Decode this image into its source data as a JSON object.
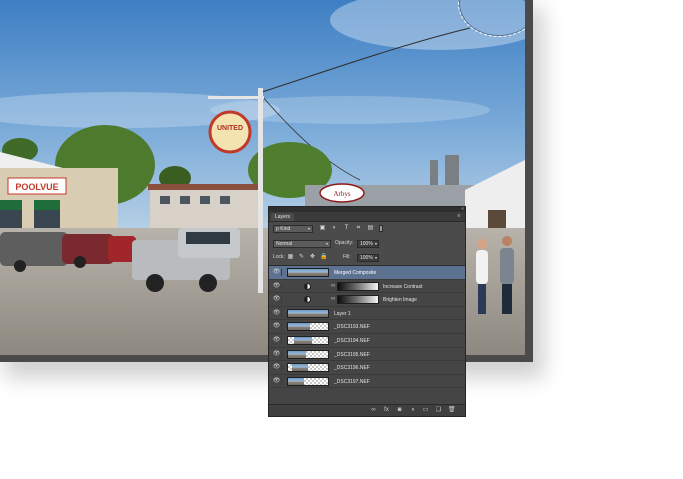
{
  "document": {
    "sign_roadside": "POOLVUE",
    "sign_round": "UNITED",
    "sign_oval": "Arbys"
  },
  "layers_panel": {
    "tab_label": "Layers",
    "collapse_glyph": "«",
    "menu_glyph": "≡",
    "filter": {
      "kind_label": "Kind",
      "kind_prefix": "ρ",
      "caret": "▾",
      "icons": [
        "image-filter-icon",
        "adjustment-filter-icon",
        "type-filter-icon",
        "shape-filter-icon",
        "smart-object-filter-icon"
      ],
      "glyphs": [
        "▣",
        "◐",
        "T",
        "⌗",
        "▤"
      ]
    },
    "blend_mode": "Normal",
    "opacity_label": "Opacity:",
    "opacity_value": "100%",
    "lock_label": "Lock:",
    "lock_glyphs": [
      "▦",
      "✎",
      "✥",
      "🔒"
    ],
    "fill_label": "Fill:",
    "fill_value": "100%",
    "eye_glyph": "👁",
    "chain_glyph": "∞",
    "layers": [
      {
        "name": "Merged Composite",
        "kind": "pixel",
        "selected": true,
        "thumb": "full"
      },
      {
        "name": "Increase Contrast",
        "kind": "adjustment",
        "selected": false
      },
      {
        "name": "Brighten Image",
        "kind": "adjustment",
        "selected": false
      },
      {
        "name": "Layer 1",
        "kind": "pixel",
        "selected": false,
        "thumb": "full"
      },
      {
        "name": "_DSC3193.NEF",
        "kind": "pixel",
        "selected": false,
        "thumb": "partial",
        "chip_start": 0.0,
        "chip_end": 0.55
      },
      {
        "name": "_DSC3194.NEF",
        "kind": "pixel",
        "selected": false,
        "thumb": "partial",
        "chip_start": 0.15,
        "chip_end": 0.6
      },
      {
        "name": "_DSC3195.NEF",
        "kind": "pixel",
        "selected": false,
        "thumb": "partial",
        "chip_start": 0.0,
        "chip_end": 0.45
      },
      {
        "name": "_DSC3196.NEF",
        "kind": "pixel",
        "selected": false,
        "thumb": "partial",
        "chip_start": 0.1,
        "chip_end": 0.5
      },
      {
        "name": "_DSC3197.NEF",
        "kind": "pixel",
        "selected": false,
        "thumb": "partial",
        "chip_start": 0.0,
        "chip_end": 0.4
      }
    ],
    "footer": {
      "icons": [
        "link-layers-icon",
        "layer-style-icon",
        "add-mask-icon",
        "new-adjustment-icon",
        "new-group-icon",
        "new-layer-icon",
        "delete-layer-icon"
      ],
      "glyphs": [
        "∞",
        "fx",
        "◙",
        "◑",
        "▭",
        "❏",
        "🗑"
      ]
    }
  }
}
